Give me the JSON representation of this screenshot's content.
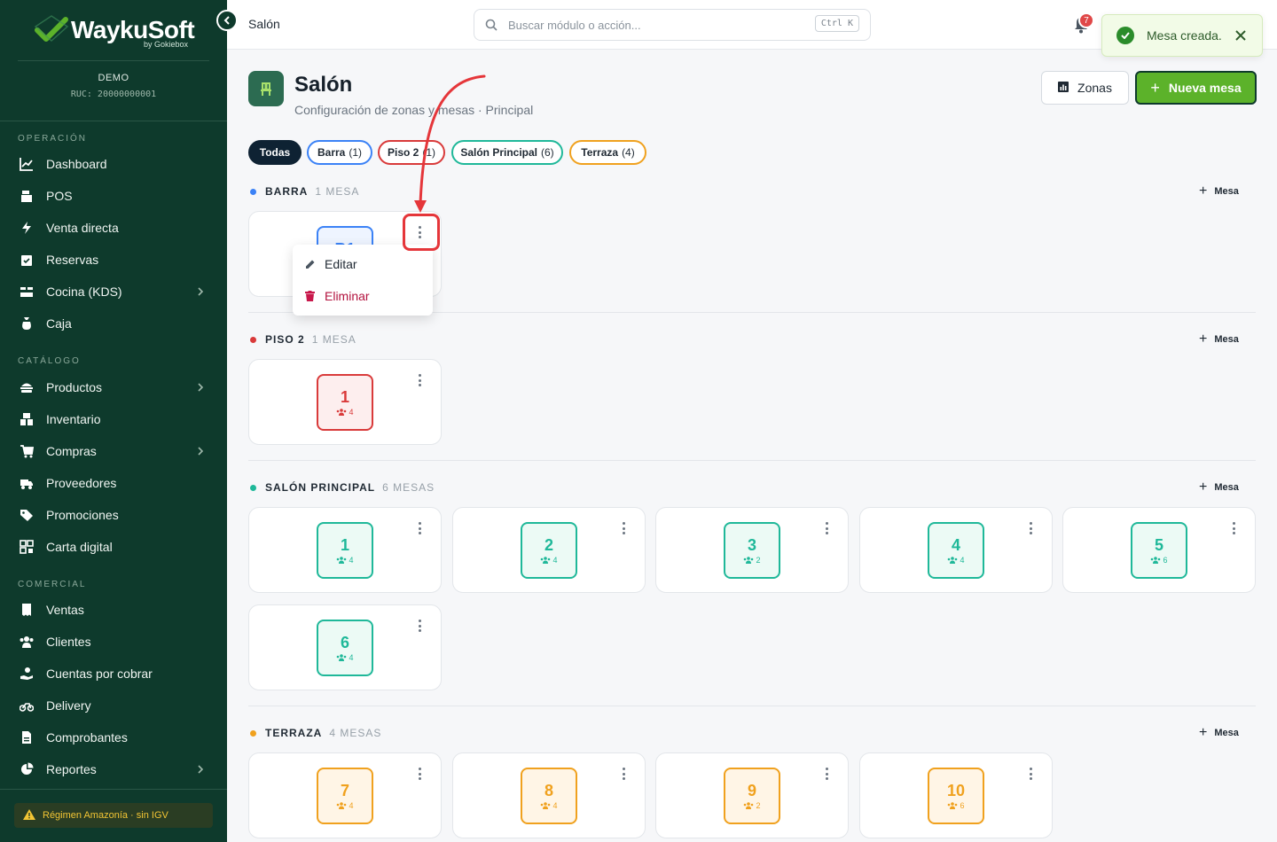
{
  "sidebar": {
    "brand": "WaykuSoft",
    "brand_sub": "by Gokiebox",
    "org_name": "DEMO",
    "org_ruc": "RUC: 20000000001",
    "sections": [
      {
        "title": "OPERACIÓN",
        "items": [
          {
            "label": "Dashboard",
            "icon": "chart-line-icon"
          },
          {
            "label": "POS",
            "icon": "cash-register-icon"
          },
          {
            "label": "Venta directa",
            "icon": "bolt-icon"
          },
          {
            "label": "Reservas",
            "icon": "calendar-check-icon"
          },
          {
            "label": "Cocina (KDS)",
            "icon": "kitchen-icon",
            "expandable": true
          },
          {
            "label": "Caja",
            "icon": "cash-bag-icon"
          }
        ]
      },
      {
        "title": "CATÁLOGO",
        "items": [
          {
            "label": "Productos",
            "icon": "burger-icon",
            "expandable": true
          },
          {
            "label": "Inventario",
            "icon": "boxes-icon"
          },
          {
            "label": "Compras",
            "icon": "cart-icon",
            "expandable": true
          },
          {
            "label": "Proveedores",
            "icon": "truck-icon"
          },
          {
            "label": "Promociones",
            "icon": "tags-icon"
          },
          {
            "label": "Carta digital",
            "icon": "qr-icon"
          }
        ]
      },
      {
        "title": "COMERCIAL",
        "items": [
          {
            "label": "Ventas",
            "icon": "receipt-icon"
          },
          {
            "label": "Clientes",
            "icon": "users-icon"
          },
          {
            "label": "Cuentas por cobrar",
            "icon": "hand-coin-icon"
          },
          {
            "label": "Delivery",
            "icon": "motorcycle-icon"
          },
          {
            "label": "Comprobantes",
            "icon": "file-icon"
          },
          {
            "label": "Reportes",
            "icon": "pie-chart-icon",
            "expandable": true
          }
        ]
      }
    ],
    "regimen": "Régimen Amazonía · sin IGV"
  },
  "topbar": {
    "title": "Salón",
    "search_placeholder": "Buscar módulo o acción...",
    "shortcut": "Ctrl K",
    "notif_count": "7"
  },
  "toast": {
    "message": "Mesa creada."
  },
  "header": {
    "title": "Salón",
    "subtitle": "Configuración de zonas y mesas · Principal",
    "zonas_label": "Zonas",
    "nueva_label": "Nueva mesa"
  },
  "filters": [
    {
      "label": "Todas",
      "count": ""
    },
    {
      "label": "Barra",
      "count": "(1)"
    },
    {
      "label": "Piso 2",
      "count": "(1)"
    },
    {
      "label": "Salón Principal",
      "count": "(6)"
    },
    {
      "label": "Terraza",
      "count": "(4)"
    }
  ],
  "colors": {
    "accent": "#5cb22a",
    "sidebar": "#0e3a2c",
    "barra": "#3b82f6",
    "piso2": "#d93a3a",
    "salon": "#1fb899",
    "terraza": "#f0a11e"
  },
  "add_mesa_label": "Mesa",
  "zones": [
    {
      "name": "BARRA",
      "count": "1 MESA",
      "tables": [
        {
          "num": "B1",
          "cap": "4"
        }
      ]
    },
    {
      "name": "PISO 2",
      "count": "1 MESA",
      "tables": [
        {
          "num": "1",
          "cap": "4"
        }
      ]
    },
    {
      "name": "SALÓN PRINCIPAL",
      "count": "6 MESAS",
      "tables": [
        {
          "num": "1",
          "cap": "4"
        },
        {
          "num": "2",
          "cap": "4"
        },
        {
          "num": "3",
          "cap": "2"
        },
        {
          "num": "4",
          "cap": "4"
        },
        {
          "num": "5",
          "cap": "6"
        },
        {
          "num": "6",
          "cap": "4"
        }
      ]
    },
    {
      "name": "TERRAZA",
      "count": "4 MESAS",
      "tables": [
        {
          "num": "7",
          "cap": "4"
        },
        {
          "num": "8",
          "cap": "4"
        },
        {
          "num": "9",
          "cap": "2"
        },
        {
          "num": "10",
          "cap": "6"
        }
      ]
    }
  ],
  "context_menu": {
    "edit": "Editar",
    "delete": "Eliminar"
  }
}
